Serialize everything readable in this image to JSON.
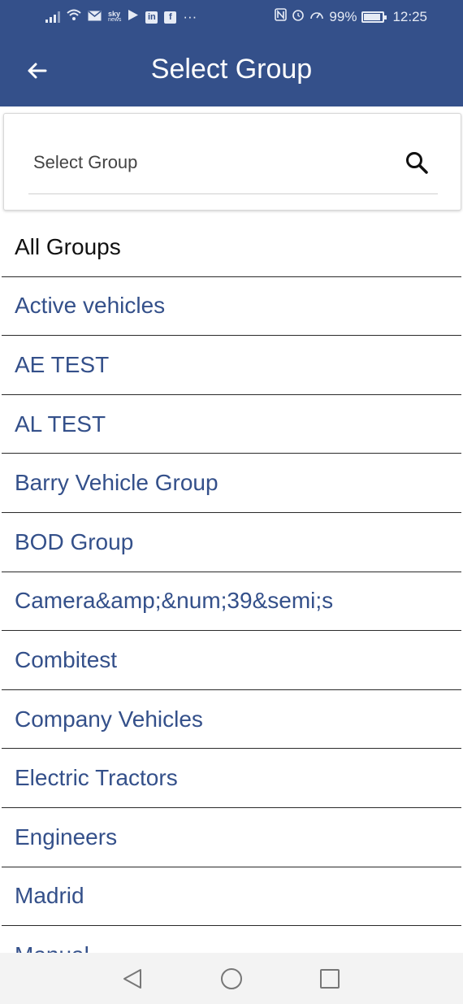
{
  "status_bar": {
    "battery": "99%",
    "time": "12:25",
    "sky_label_top": "sky",
    "sky_label_bottom": "news",
    "overflow": "···",
    "left_icons": [
      "signal-icon",
      "wifi-icon",
      "mail-icon",
      "sky-news-icon",
      "play-icon",
      "linkedin-icon",
      "facebook-icon"
    ],
    "right_icons": [
      "nfc-icon",
      "alarm-icon",
      "speed-icon",
      "battery-icon"
    ],
    "linkedin_glyph": "in",
    "facebook_glyph": "f"
  },
  "header": {
    "title": "Select Group",
    "back_icon": "arrow-left-icon",
    "color": "#34508a"
  },
  "search": {
    "placeholder": "Select Group",
    "value": "",
    "icon": "search-icon"
  },
  "list": {
    "items": [
      {
        "label": "All Groups"
      },
      {
        "label": "Active vehicles"
      },
      {
        "label": "AE TEST"
      },
      {
        "label": "AL TEST"
      },
      {
        "label": "Barry Vehicle Group"
      },
      {
        "label": "BOD Group"
      },
      {
        "label": "Camera&amp;&num;39&semi;s"
      },
      {
        "label": "Combitest"
      },
      {
        "label": "Company Vehicles"
      },
      {
        "label": "Electric Tractors"
      },
      {
        "label": "Engineers"
      },
      {
        "label": "Madrid"
      },
      {
        "label": "Manual"
      }
    ]
  },
  "nav": {
    "icons": [
      "back-triangle-icon",
      "home-circle-icon",
      "recents-square-icon"
    ]
  }
}
